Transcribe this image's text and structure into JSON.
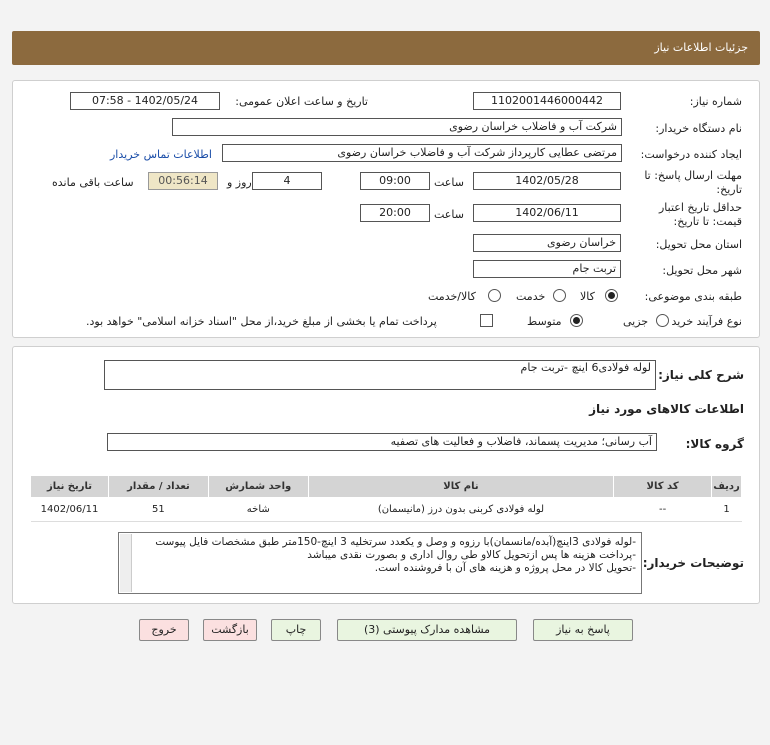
{
  "header": {
    "title": "جزئیات اطلاعات نیاز"
  },
  "form": {
    "need_number_label": "شماره نیاز:",
    "need_number": "1102001446000442",
    "announce_label": "تاریخ و ساعت اعلان عمومی:",
    "announce_value": "1402/05/24 - 07:58",
    "buyer_label": "نام دستگاه خریدار:",
    "buyer_value": "شرکت آب و فاضلاب خراسان رضوی",
    "creator_label": "ایجاد کننده درخواست:",
    "creator_value": "مرتضی عطایی کارپرداز شرکت آب و فاضلاب خراسان رضوی",
    "contact_link": "اطلاعات تماس خریدار",
    "deadline_label_1": "مهلت ارسال پاسخ: تا",
    "deadline_label_2": "تاریخ:",
    "deadline_date": "1402/05/28",
    "time_label": "ساعت",
    "deadline_time": "09:00",
    "days_value": "4",
    "days_label": "روز و",
    "remaining_value": "00:56:14",
    "remaining_label": "ساعت باقی مانده",
    "validity_label_1": "حداقل تاریخ اعتبار",
    "validity_label_2": "قیمت: تا تاریخ:",
    "validity_date": "1402/06/11",
    "validity_time_label": "ساعت",
    "validity_time": "20:00",
    "province_label": "استان محل تحویل:",
    "province_value": "خراسان رضوی",
    "city_label": "شهر محل تحویل:",
    "city_value": "تربت جام",
    "category_label": "طبقه بندی موضوعی:",
    "category_options": [
      "کالا",
      "خدمت",
      "کالا/خدمت"
    ],
    "process_label": "نوع فرآیند خرید :",
    "process_options": [
      "جزیی",
      "متوسط"
    ],
    "payment_note": "پرداخت تمام یا بخشی از مبلغ خرید،از محل \"اسناد خزانه اسلامی\" خواهد بود."
  },
  "details": {
    "summary_label": "شرح کلی نیاز:",
    "summary_value": "لوله فولادی6 اینچ -تربت جام",
    "goods_title": "اطلاعات کالاهای مورد نیاز",
    "group_label": "گروه کالا:",
    "group_value": "آب رسانی؛ مدیریت پسماند، فاضلاب و فعالیت های تصفیه",
    "table": {
      "headers": [
        "ردیف",
        "کد کالا",
        "نام کالا",
        "واحد شمارش",
        "تعداد / مقدار",
        "تاریخ نیاز"
      ],
      "rows": [
        [
          "1",
          "--",
          "لوله فولادی کربنی بدون درز (مانیسمان)",
          "شاخه",
          "51",
          "1402/06/11"
        ]
      ]
    },
    "buyer_notes_label": "توضیحات خریدار:",
    "buyer_notes": [
      "-لوله فولادی 3اینچ(آبده/مانسمان)با رزوه و وصل و یکعدد سرتخلیه 3 اینچ-150متر طبق مشخصات فایل پیوست",
      "-پرداخت هزینه ها پس ازتحویل کالاو طی روال اداری و بصورت نقدی میباشد",
      "-تحویل کالا در محل پروژه و هزینه های آن با فروشنده است."
    ]
  },
  "buttons": {
    "reply": "پاسخ به نیاز",
    "attachments": "مشاهده مدارک پیوستی (3)",
    "print": "چاپ",
    "back": "بازگشت",
    "exit": "خروج"
  }
}
